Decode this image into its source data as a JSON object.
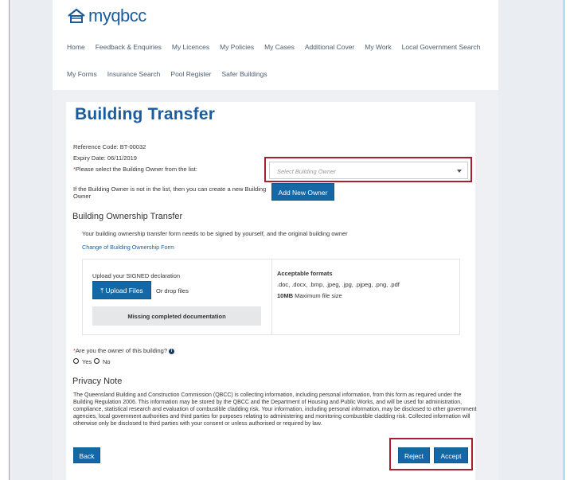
{
  "brand": {
    "name": "myqbcc"
  },
  "nav": {
    "row1": [
      "Home",
      "Feedback & Enquiries",
      "My Licences",
      "My Policies",
      "My Cases",
      "Additional Cover",
      "My Work",
      "Local Government Search"
    ],
    "row2": [
      "My Forms",
      "Insurance Search",
      "Pool Register",
      "Safer Buildings"
    ]
  },
  "page": {
    "title": "Building Transfer",
    "reference_code": "Reference Code: BT-00032",
    "expiry_date": "Expiry Date: 06/11/2019",
    "owner_select_label": "Please select the Building Owner from the list:",
    "owner_select_placeholder": "Select Building Owner",
    "not_in_list_text_1": "If the Building Owner is not in the list, then you can create a new Building",
    "not_in_list_text_2": "Owner",
    "add_new_owner_label": "Add New Owner"
  },
  "ownership": {
    "heading": "Building Ownership Transfer",
    "description": "Your building ownership transfer form needs to be signed by yourself, and the original building owner",
    "form_link": "Change of Building Ownership Form",
    "upload_label": "Upload your SIGNED declaration",
    "upload_button": "Upload Files",
    "drop_text": "Or drop files",
    "missing_text": "Missing completed documentation",
    "formats_heading": "Acceptable formats",
    "formats_list": ".doc, .docx, .bmp, .jpeg, .jpg, .pjpeg, .png, .pdf",
    "max_size_bold": "10MB",
    "max_size_text": "Maximum file size"
  },
  "owner_question": {
    "label": "Are you the owner of this building?",
    "yes": "Yes",
    "no": "No"
  },
  "privacy": {
    "heading": "Privacy Note",
    "text": "The Queensland Building and Construction Commission (QBCC) is collecting information, including personal information, from this form as required under the Building Regulation 2006. This information may be stored by the QBCC and the Department of Housing and Public Works, and will be used for administration, compliance, statistical research and evaluation of combustible cladding risk. Your information, including personal information, may be disclosed to other government agencies, local government authorities and third parties for purposes relating to administering and monitoring combustible cladding risk. Collected information will otherwise only be disclosed to third parties with your consent or unless authorised or required by law."
  },
  "actions": {
    "back": "Back",
    "reject": "Reject",
    "accept": "Accept"
  },
  "colors": {
    "brand_blue": "#1a5c9e",
    "button_blue": "#1368a5",
    "highlight_red": "#a8202f"
  }
}
